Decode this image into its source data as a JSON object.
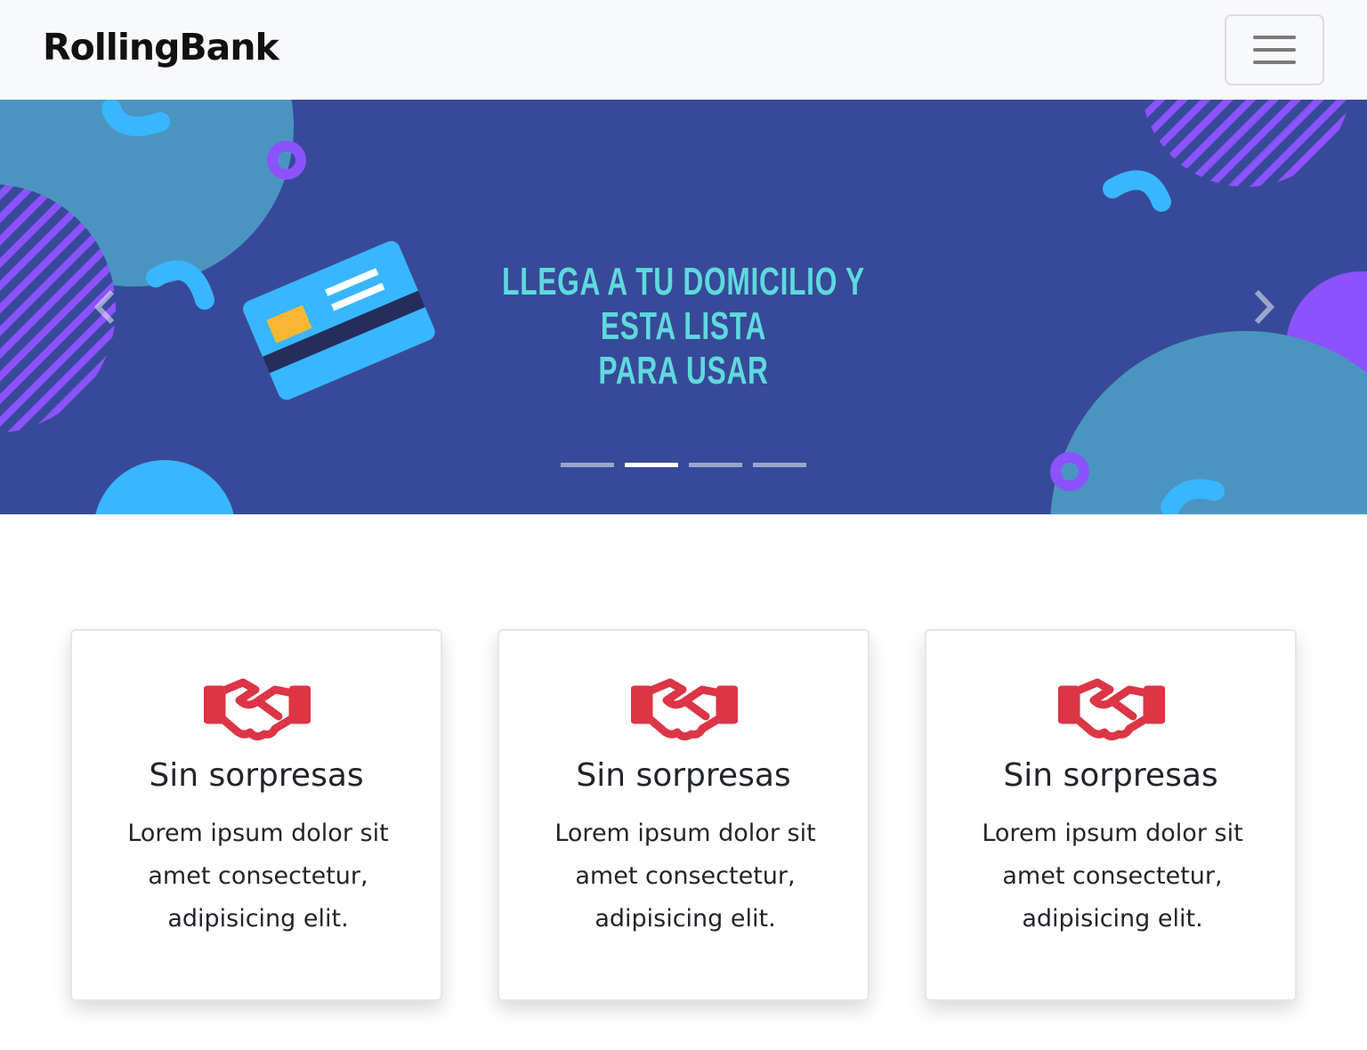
{
  "navbar": {
    "brand": "RollingBank",
    "toggler_icon": "hamburger-menu-icon"
  },
  "carousel": {
    "caption_line1": "LLEGA A TU DOMICILIO Y ESTA LISTA",
    "caption_line2": "PARA USAR",
    "prev_icon": "chevron-left-icon",
    "next_icon": "chevron-right-icon",
    "indicator_count": 4,
    "active_indicator": 2,
    "colors": {
      "background": "#374a99",
      "caption": "#5fd9dd",
      "teal_blob": "#4a95c0",
      "purple": "#8c52ff",
      "cyan": "#38b6ff",
      "card_blue": "#38b6ff",
      "card_chip": "#f7b733"
    }
  },
  "cards": [
    {
      "icon": "handshake-icon",
      "title": "Sin sorpresas",
      "text": "Lorem ipsum dolor sit amet consectetur, adipisicing elit."
    },
    {
      "icon": "handshake-icon",
      "title": "Sin sorpresas",
      "text": "Lorem ipsum dolor sit amet consectetur, adipisicing elit."
    },
    {
      "icon": "handshake-icon",
      "title": "Sin sorpresas",
      "text": "Lorem ipsum dolor sit amet consectetur, adipisicing elit."
    }
  ],
  "accent_color": "#dc3545"
}
